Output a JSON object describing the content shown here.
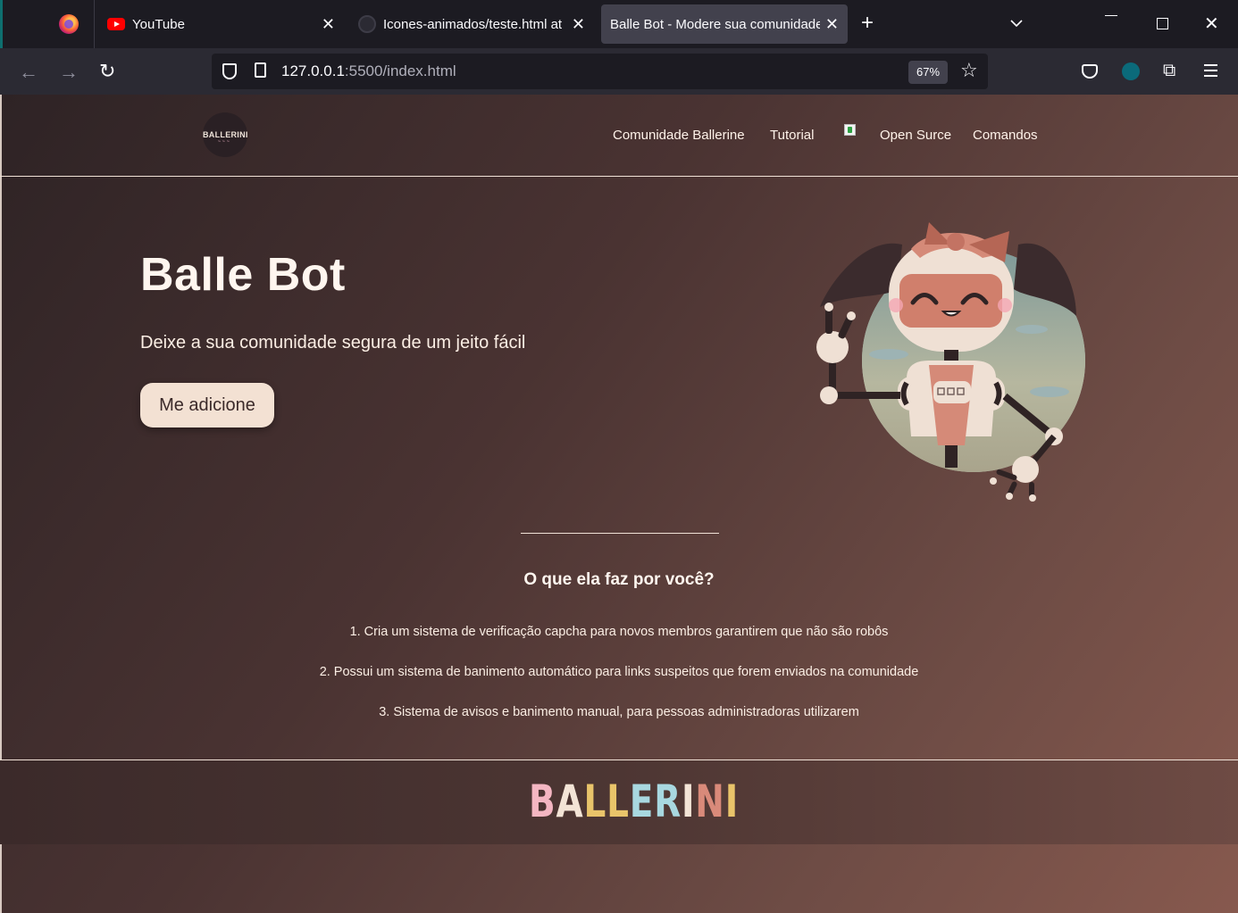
{
  "browser": {
    "tabs": [
      {
        "title": "YouTube",
        "icon": "youtube-icon"
      },
      {
        "title": "Icones-animados/teste.html at",
        "icon": "github-icon"
      },
      {
        "title": "Balle Bot - Modere sua comunidade",
        "icon": "",
        "active": true
      }
    ],
    "url_main": "127.0.0.1",
    "url_rest": ":5500/index.html",
    "zoom": "67%"
  },
  "header": {
    "logo_text": "BALLERINI",
    "menu": [
      "Comunidade Ballerine",
      "Tutorial",
      "Open Surce",
      "Comandos"
    ]
  },
  "hero": {
    "title": "Balle Bot",
    "subtitle": "Deixe a sua comunidade segura de um jeito fácil",
    "button": "Me adicione"
  },
  "features": {
    "title": "O que ela faz por você?",
    "items": [
      "1. Cria um sistema de verificação capcha para novos membros garantirem que não são robôs",
      "2. Possui um sistema de banimento automático para links suspeitos que forem enviados na comunidade",
      "3. Sistema de avisos e banimento manual, para pessoas administradoras utilizarem"
    ]
  },
  "footer": {
    "letters": [
      "B",
      "A",
      "L",
      "L",
      "E",
      "R",
      "I",
      "N",
      "I"
    ],
    "letter_colors": [
      "#f4b6c2",
      "#f3e4d6",
      "#e9c46a",
      "#e9c46a",
      "#a8d8e0",
      "#a8d8e0",
      "#f3e4d6",
      "#d98a7a",
      "#e9c46a"
    ]
  },
  "colors": {
    "accent_button": "#f3e1d3",
    "page_gradient_start": "#2e2325",
    "page_gradient_end": "#87594e"
  }
}
